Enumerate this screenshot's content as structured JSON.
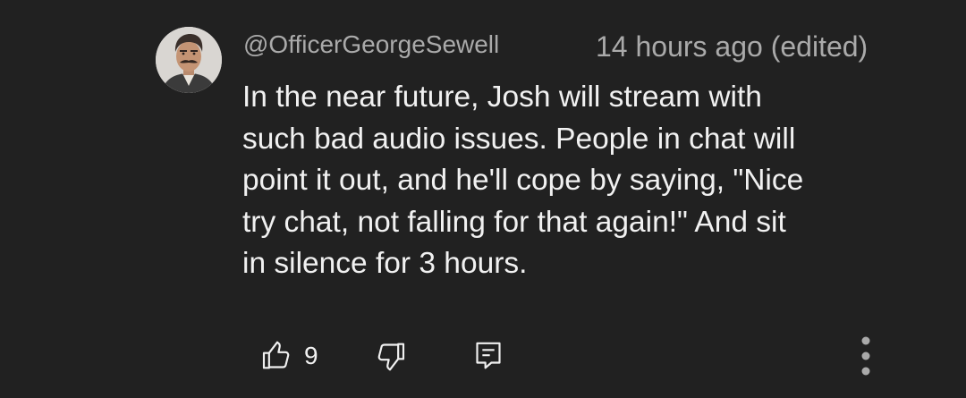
{
  "comment": {
    "author": "@OfficerGeorgeSewell",
    "timestamp": "14 hours ago (edited)",
    "lines": [
      "In the near future, Josh will stream with",
      "such bad audio issues. People in chat will",
      "point it out, and he'll cope by saying, \"Nice",
      "try chat, not falling for that again!\" And sit",
      "in silence for 3 hours."
    ]
  },
  "actions": {
    "like_count": "9",
    "like_icon": "thumbs-up-icon",
    "dislike_icon": "thumbs-down-icon",
    "reply_icon": "reply-comment-icon",
    "more_icon": "more-vertical-icon"
  },
  "colors": {
    "background": "#212121",
    "text_primary": "#f1f1f1",
    "text_secondary": "#aaaaaa"
  }
}
